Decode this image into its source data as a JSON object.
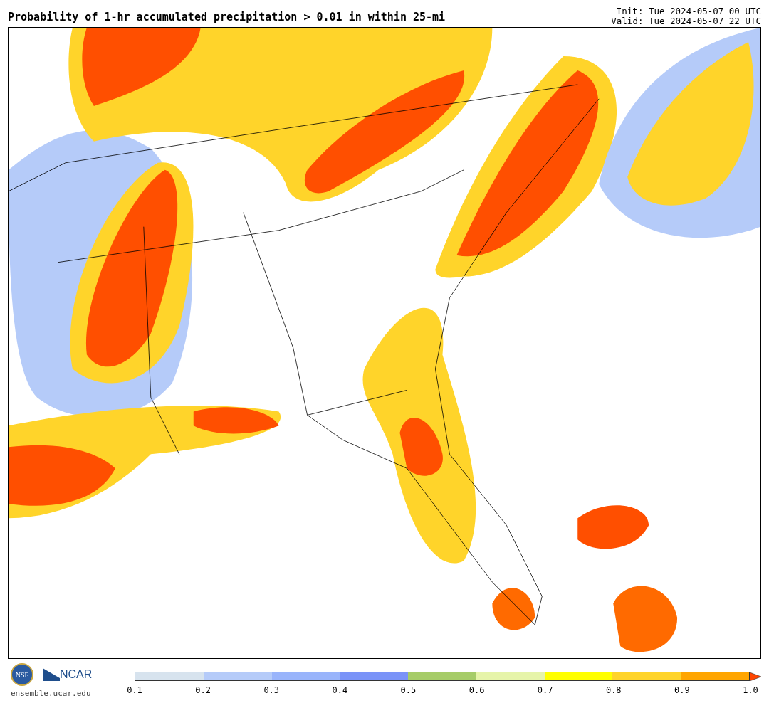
{
  "title": "Probability of 1-hr accumulated precipitation > 0.01 in within 25-mi",
  "init": "Init: Tue 2024-05-07 00 UTC",
  "valid": "Valid: Tue 2024-05-07 22 UTC",
  "logos": {
    "nsf": "NSF",
    "ncar": "NCAR",
    "site": "ensemble.ucar.edu"
  },
  "colorbar": {
    "bins": [
      {
        "color": "#d7e3ee"
      },
      {
        "color": "#b5cbf9"
      },
      {
        "color": "#99b4fb"
      },
      {
        "color": "#7a93f8"
      },
      {
        "color": "#a6cc68"
      },
      {
        "color": "#e6f4a9"
      },
      {
        "color": "#ffff00"
      },
      {
        "color": "#ffd42a"
      },
      {
        "color": "#ffa500"
      }
    ],
    "extension": {
      "color": "#ff4500"
    },
    "ticks": [
      "0.1",
      "0.2",
      "0.3",
      "0.4",
      "0.5",
      "0.6",
      "0.7",
      "0.8",
      "0.9",
      "1.0"
    ]
  }
}
